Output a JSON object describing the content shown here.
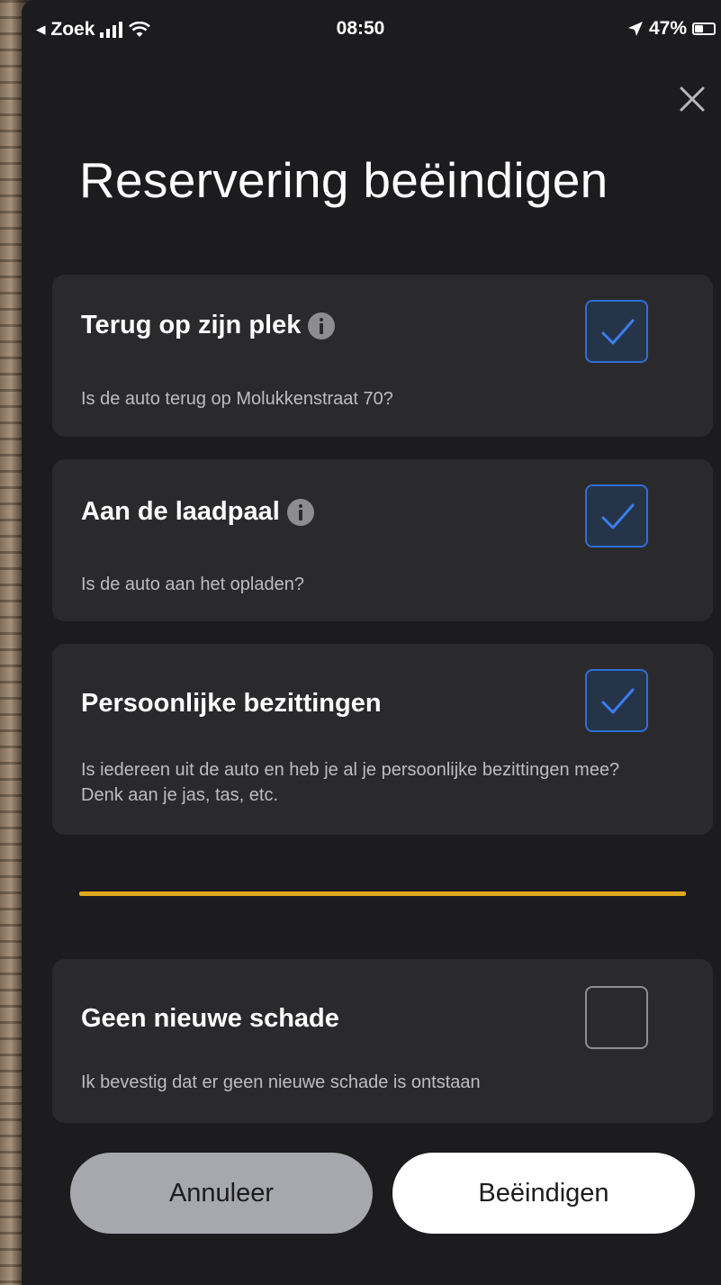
{
  "status_bar": {
    "back_label": "◂ Zoek",
    "time": "08:50",
    "battery": "47%",
    "battery_level": 0.47
  },
  "header": {
    "title": "Reservering beëindigen"
  },
  "checklist": [
    {
      "title": "Terug op zijn plek",
      "has_info": true,
      "subtitle": "Is de auto terug op Molukkenstraat 70?",
      "checked": true
    },
    {
      "title": "Aan de laadpaal",
      "has_info": true,
      "subtitle": "Is de auto aan het opladen?",
      "checked": true
    },
    {
      "title": "Persoonlijke bezittingen",
      "has_info": false,
      "subtitle": "Is iedereen uit de auto en heb je al je persoonlijke bezittingen mee? Denk aan je jas, tas, etc.",
      "checked": true
    }
  ],
  "damage": {
    "title": "Geen nieuwe schade",
    "subtitle": "Ik bevestig dat er geen nieuwe schade is ontstaan",
    "checked": false
  },
  "buttons": {
    "cancel_label": "Annuleer",
    "end_label": "Beëindigen"
  },
  "colors": {
    "sheet_background": "#1c1c1e",
    "card_background": "#2a2a2c",
    "checkbox_accent": "#2f6fd6",
    "divider_accent": "#e0a91b"
  },
  "icons": {
    "close": "close-icon",
    "info": "info-icon",
    "check": "checkmark-icon",
    "signal": "cellular-signal-icon",
    "wifi": "wifi-icon",
    "location": "location-arrow-icon",
    "battery": "battery-icon"
  }
}
